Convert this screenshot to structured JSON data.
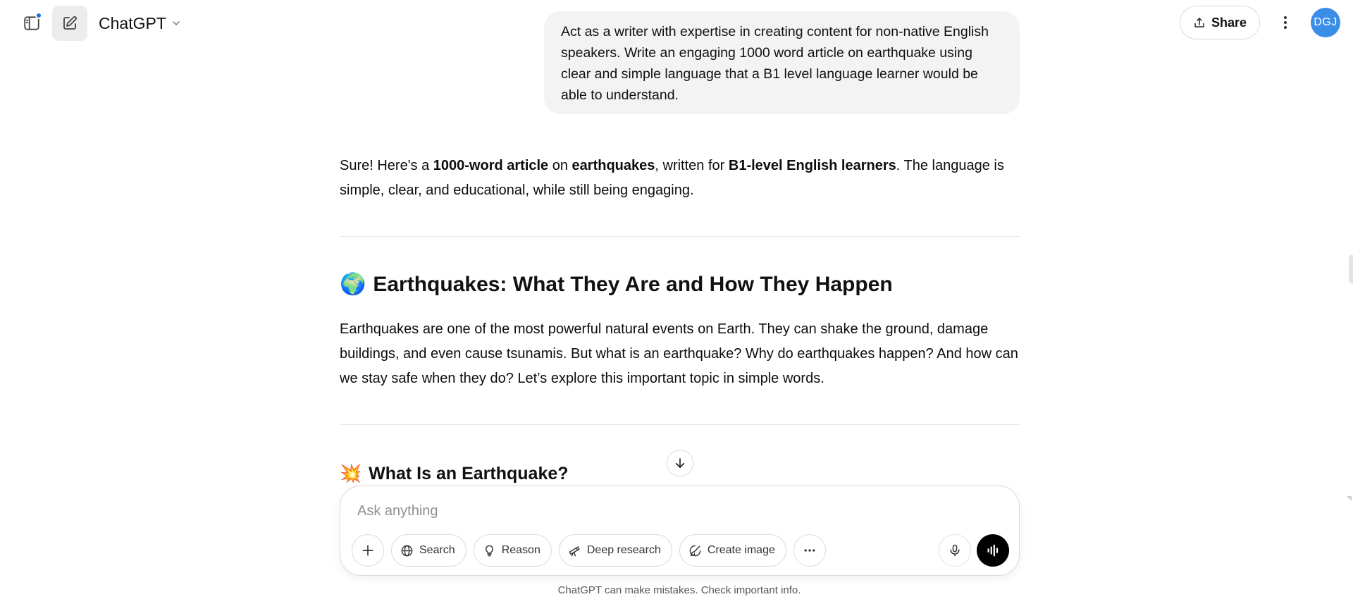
{
  "header": {
    "model_name": "ChatGPT",
    "share_label": "Share",
    "avatar_initials": "DGJ",
    "accent_color": "#1a73e8"
  },
  "user_message": "Act as a writer with expertise in creating content for non-native English speakers. Write an engaging 1000 word article on earthquake using clear and simple language that a B1 level language learner would be able to understand.",
  "assistant": {
    "intro": {
      "t1": "Sure! Here's a ",
      "b1": "1000-word article",
      "t2": " on ",
      "b2": "earthquakes",
      "t3": ", written for ",
      "b3": "B1-level English learners",
      "t4": ". The language is simple, clear, and educational, while still being engaging."
    },
    "heading1": {
      "emoji": "🌍",
      "emoji_icon": "globe-icon",
      "text": "Earthquakes: What They Are and How They Happen"
    },
    "paragraph1": "Earthquakes are one of the most powerful natural events on Earth. They can shake the ground, damage buildings, and even cause tsunamis. But what is an earthquake? Why do earthquakes happen? And how can we stay safe when they do? Let’s explore this important topic in simple words.",
    "heading2": {
      "emoji": "💥",
      "emoji_icon": "collision-icon",
      "text": "What Is an Earthquake?"
    }
  },
  "composer": {
    "placeholder": "Ask anything",
    "tools": {
      "search": "Search",
      "reason": "Reason",
      "deep_research": "Deep research",
      "create_image": "Create image"
    }
  },
  "footer_note": "ChatGPT can make mistakes. Check important info."
}
